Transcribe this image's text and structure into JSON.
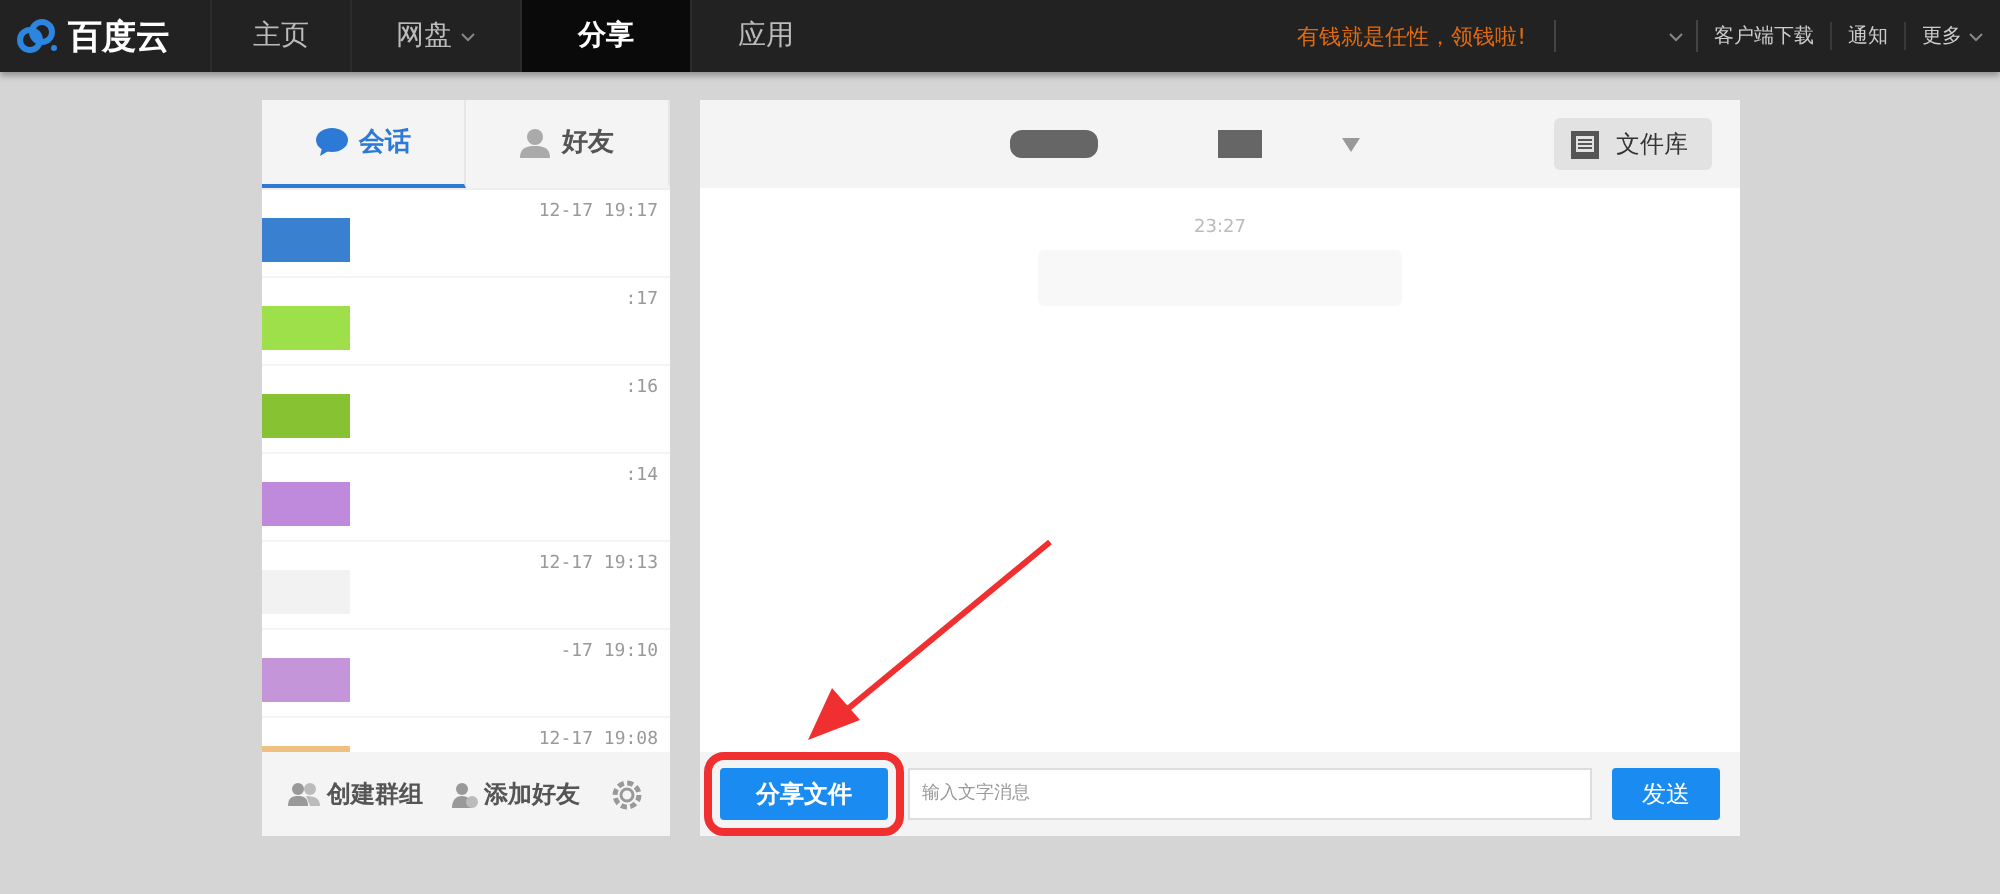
{
  "navbar": {
    "brand": "百度云",
    "items": [
      {
        "label": "主页",
        "selected": false,
        "has_caret": false
      },
      {
        "label": "网盘",
        "selected": false,
        "has_caret": true
      },
      {
        "label": "分享",
        "selected": true,
        "has_caret": false
      },
      {
        "label": "应用",
        "selected": false,
        "has_caret": false
      }
    ],
    "promo": "有钱就是任性，领钱啦!",
    "links": [
      {
        "label": "客户端下载",
        "has_caret": false
      },
      {
        "label": "通知",
        "has_caret": false
      },
      {
        "label": "更多",
        "has_caret": true
      }
    ]
  },
  "sidebar": {
    "tabs": [
      {
        "label": "会话",
        "selected": true
      },
      {
        "label": "好友",
        "selected": false
      }
    ],
    "conversations": [
      {
        "time": "12-17 19:17",
        "color": "#3a80d0"
      },
      {
        "time": ":17",
        "color": "#9ee04a"
      },
      {
        "time": ":16",
        "color": "#86c232"
      },
      {
        "time": ":14",
        "color": "#c08adc"
      },
      {
        "time": "12-17 19:13",
        "color": "#f2f2f2"
      },
      {
        "time": "-17 19:10",
        "color": "#c495d8"
      },
      {
        "time": "12-17 19:08",
        "color": "#f0c080"
      }
    ],
    "footer": [
      "创建群组",
      "添加好友"
    ]
  },
  "chat": {
    "library_button": "文件库",
    "messages": [
      {
        "time": "23:27"
      }
    ],
    "share_button": "分享文件",
    "input": {
      "placeholder": "输入文字消息"
    },
    "send_button": "发送"
  }
}
